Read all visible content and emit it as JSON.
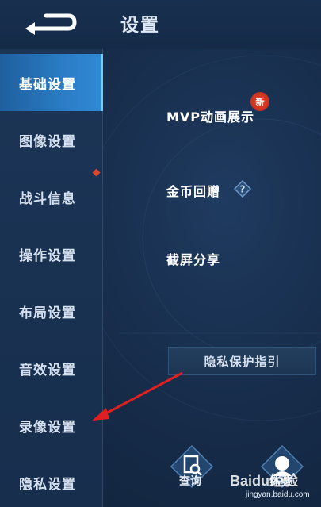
{
  "header": {
    "title": "设置"
  },
  "sidebar": {
    "items": [
      {
        "label": "基础设置"
      },
      {
        "label": "图像设置"
      },
      {
        "label": "战斗信息"
      },
      {
        "label": "操作设置"
      },
      {
        "label": "布局设置"
      },
      {
        "label": "音效设置"
      },
      {
        "label": "录像设置"
      },
      {
        "label": "隐私设置"
      }
    ],
    "active_index": 0
  },
  "options": {
    "mvp_animation": "MVP动画展示",
    "new_badge": "新",
    "coin_gift": "金币回赠",
    "screenshot_share": "截屏分享"
  },
  "privacy_guide_button": "隐私保护指引",
  "bottom": {
    "query_label": "查询",
    "experience_label": "体验"
  },
  "watermark": {
    "brand": "Baidu经验",
    "url": "jingyan.baidu.com"
  },
  "colors": {
    "accent": "#2a7cc4",
    "badge": "#e0452d",
    "arrow": "#e02020"
  }
}
